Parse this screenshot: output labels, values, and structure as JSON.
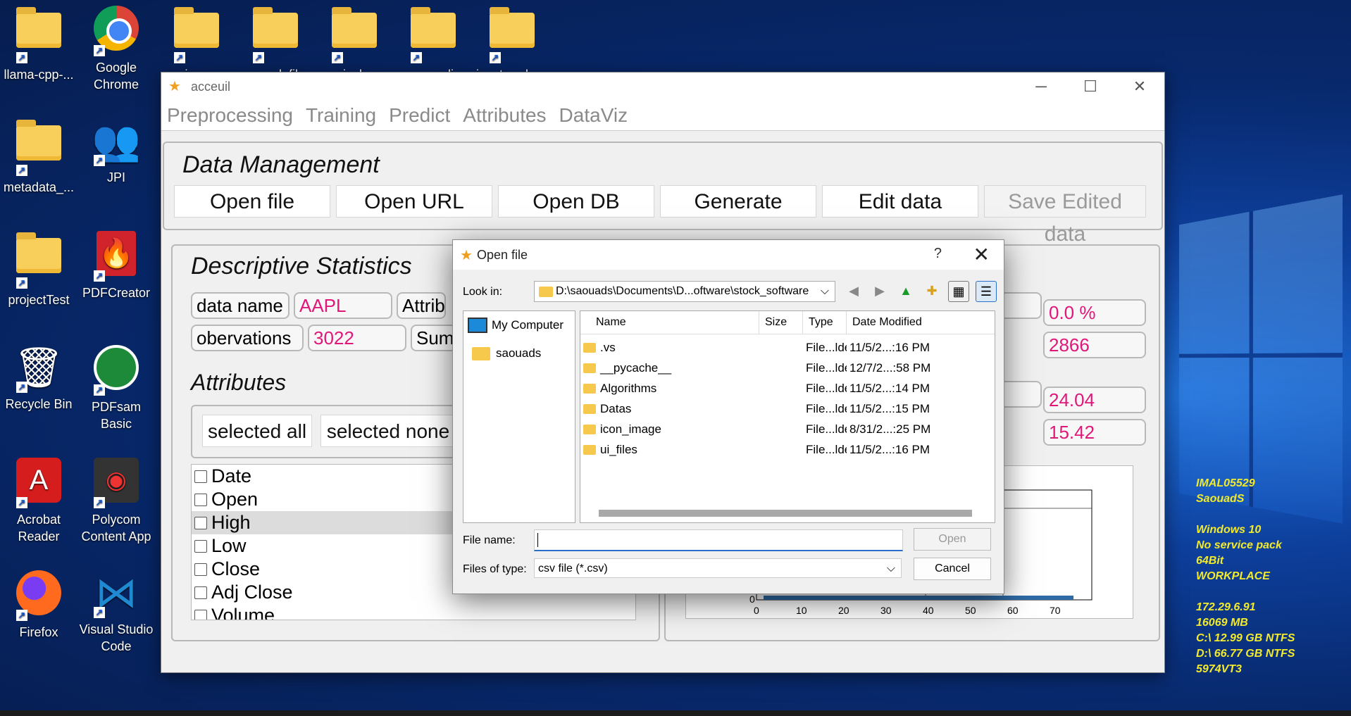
{
  "desktop": {
    "icons": [
      {
        "label": "llama-cpp-...",
        "icon": "folder"
      },
      {
        "label": "Google Chrome",
        "icon": "chrome"
      },
      {
        "label": "iesa",
        "icon": "folder"
      },
      {
        "label": "general_files",
        "icon": "folder"
      },
      {
        "label": "mainclone",
        "icon": "folder"
      },
      {
        "label": "ecomdi",
        "icon": "folder"
      },
      {
        "label": "jupyter_docs",
        "icon": "folder"
      },
      {
        "label": "metadata_...",
        "icon": "folder"
      },
      {
        "label": "JPI",
        "icon": "people"
      },
      {
        "label": "projectTest",
        "icon": "folder"
      },
      {
        "label": "PDFCreator",
        "icon": "pdfcreator"
      },
      {
        "label": "Recycle Bin",
        "icon": "recycle-bin"
      },
      {
        "label": "PDFsam Basic",
        "icon": "pdfsam"
      },
      {
        "label": "Acrobat Reader",
        "icon": "acrobat"
      },
      {
        "label": "Polycom Content App",
        "icon": "polycom"
      },
      {
        "label": "Firefox",
        "icon": "firefox"
      },
      {
        "label": "Visual Studio Code",
        "icon": "vscode"
      }
    ],
    "sysinfo": "IMAL05529\nSaouadS\n\nWindows 10\nNo service pack\n64Bit\nWORKPLACE\n\n172.29.6.91\n16069 MB\nC:\\ 12.99 GB NTFS\nD:\\ 66.77 GB NTFS\n5974VT3"
  },
  "app": {
    "title": "acceuil",
    "menu": [
      "Preprocessing",
      "Training",
      "Predict",
      "Attributes",
      "DataViz"
    ],
    "data_management": {
      "title": "Data Management",
      "buttons": [
        "Open file",
        "Open URL",
        "Open DB",
        "Generate",
        "Edit data",
        "Save Edited data"
      ]
    },
    "stats": {
      "title": "Descriptive Statistics",
      "data_name_label": "data name",
      "data_name_value": "AAPL",
      "observations_label": "obervations",
      "observations_value": "3022",
      "attrib_label": "Attribu",
      "sum_label": "Sum o",
      "right_values": [
        "0.0 %",
        "2866",
        "24.04",
        "15.42"
      ]
    },
    "attributes": {
      "title": "Attributes",
      "select_all": "selected all",
      "select_none": "selected none",
      "items": [
        "Date",
        "Open",
        "High",
        "Low",
        "Close",
        "Adj Close",
        "Volume"
      ],
      "highlighted_index": 2
    },
    "chart": {
      "x_ticks": [
        "0",
        "10",
        "20",
        "30",
        "40",
        "50",
        "60",
        "70"
      ],
      "y_ticks": [
        "0"
      ]
    }
  },
  "dialog": {
    "title": "Open file",
    "help": "?",
    "look_in_label": "Look in:",
    "path": "D:\\saouads\\Documents\\D...oftware\\stock_software",
    "sidebar": [
      "My Computer",
      "saouads"
    ],
    "columns": [
      "Name",
      "Size",
      "Type",
      "Date Modified"
    ],
    "files": [
      {
        "name": ".vs",
        "type": "File...lder",
        "date": "11/5/2...:16 PM"
      },
      {
        "name": "__pycache__",
        "type": "File...lder",
        "date": "12/7/2...:58 PM"
      },
      {
        "name": "Algorithms",
        "type": "File...lder",
        "date": "11/5/2...:14 PM"
      },
      {
        "name": "Datas",
        "type": "File...lder",
        "date": "11/5/2...:15 PM"
      },
      {
        "name": "icon_image",
        "type": "File...lder",
        "date": "8/31/2...:25 PM"
      },
      {
        "name": "ui_files",
        "type": "File...lder",
        "date": "11/5/2...:16 PM"
      }
    ],
    "file_name_label": "File name:",
    "file_name_value": "",
    "file_type_label": "Files of type:",
    "file_type_value": "csv file (*.csv)",
    "open_button": "Open",
    "cancel_button": "Cancel"
  }
}
